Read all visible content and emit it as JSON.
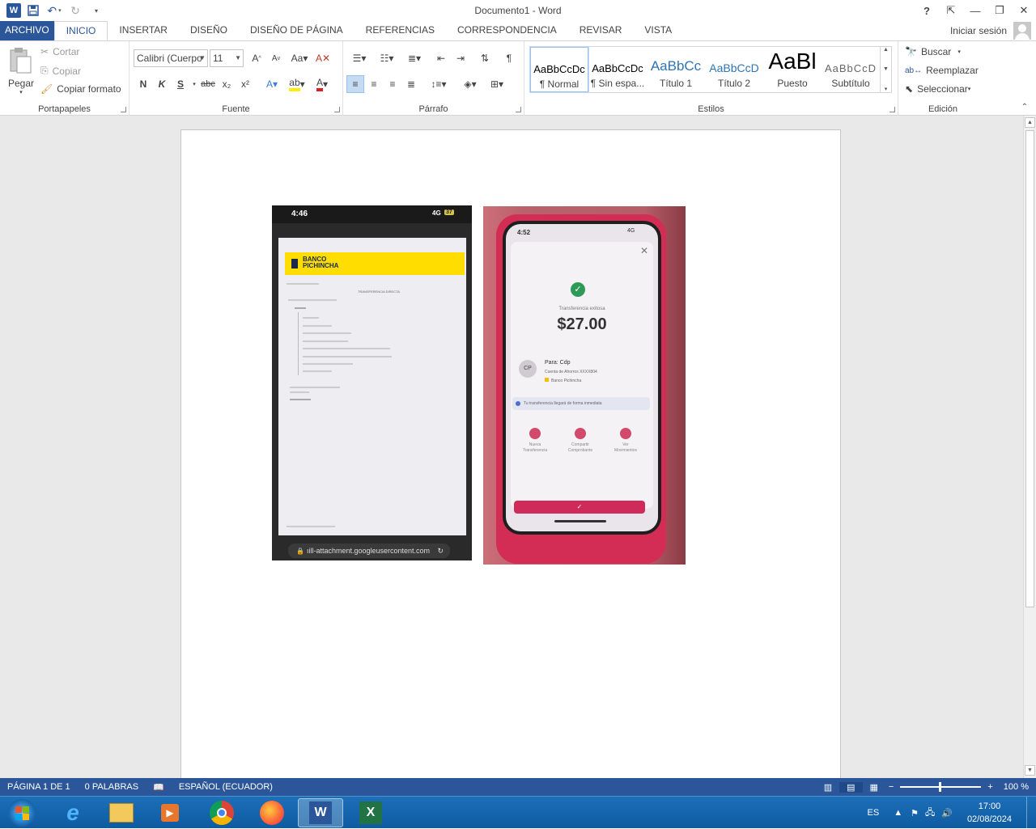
{
  "window": {
    "title": "Documento1 - Word"
  },
  "quick_access": {
    "icons": [
      "word-logo",
      "save-icon",
      "undo-icon",
      "redo-icon",
      "customize-icon"
    ]
  },
  "tabs": [
    {
      "label": "ARCHIVO"
    },
    {
      "label": "INICIO"
    },
    {
      "label": "INSERTAR"
    },
    {
      "label": "DISEÑO"
    },
    {
      "label": "DISEÑO DE PÁGINA"
    },
    {
      "label": "REFERENCIAS"
    },
    {
      "label": "CORRESPONDENCIA"
    },
    {
      "label": "REVISAR"
    },
    {
      "label": "VISTA"
    }
  ],
  "active_tab": "INICIO",
  "signin": "Iniciar sesión",
  "ribbon": {
    "clipboard": {
      "paste": "Pegar",
      "cut": "Cortar",
      "copy": "Copiar",
      "format_painter": "Copiar formato",
      "label": "Portapapeles"
    },
    "font": {
      "name": "Calibri (Cuerpo",
      "size": "11",
      "label": "Fuente",
      "bold": "N",
      "italic": "K",
      "underline": "S",
      "strike": "abc",
      "sub": "x₂",
      "sup": "x²"
    },
    "paragraph": {
      "label": "Párrafo"
    },
    "styles": {
      "label": "Estilos",
      "items": [
        {
          "preview": "AaBbCcDc",
          "name": "¶ Normal"
        },
        {
          "preview": "AaBbCcDc",
          "name": "¶ Sin espa..."
        },
        {
          "preview": "AaBbCc",
          "name": "Título 1"
        },
        {
          "preview": "AaBbCcD",
          "name": "Título 2"
        },
        {
          "preview": "AaBl",
          "name": "Puesto"
        },
        {
          "preview": "AaBbCcD",
          "name": "Subtítulo"
        }
      ]
    },
    "editing": {
      "label": "Edición",
      "find": "Buscar",
      "replace": "Reemplazar",
      "select": "Seleccionar"
    }
  },
  "photo1": {
    "time": "4:46",
    "signal": "4G",
    "battery": "37",
    "bank_line1": "BANCO",
    "bank_line2": "PICHINCHA",
    "doc_heading": "TRANSFERENCIA DIRECTA",
    "url": "ıill-attachment.googleusercontent.com"
  },
  "photo2": {
    "time": "4:52",
    "signal": "4G",
    "status": "Transferencia exitosa",
    "amount": "$27.00",
    "initials": "CP",
    "to": "Para: Cdp",
    "account": "Cuenta de Ahorros XXXX804",
    "bank": "Banco Pichincha",
    "notice": "Tu transferencia llegará de forma inmediata",
    "actions": [
      {
        "line1": "Nueva",
        "line2": "Transferencia"
      },
      {
        "line1": "Compartir",
        "line2": "Comprobante"
      },
      {
        "line1": "Ver",
        "line2": "Movimientos"
      }
    ]
  },
  "status": {
    "page": "PÁGINA 1 DE 1",
    "words": "0 PALABRAS",
    "language": "ESPAÑOL (ECUADOR)",
    "zoom": "100 %"
  },
  "taskbar": {
    "lang": "ES",
    "time": "17:00",
    "date": "02/08/2024"
  },
  "colors": {
    "accent": "#2b579a",
    "taskbar": "#1565ad",
    "excel": "#217346"
  }
}
